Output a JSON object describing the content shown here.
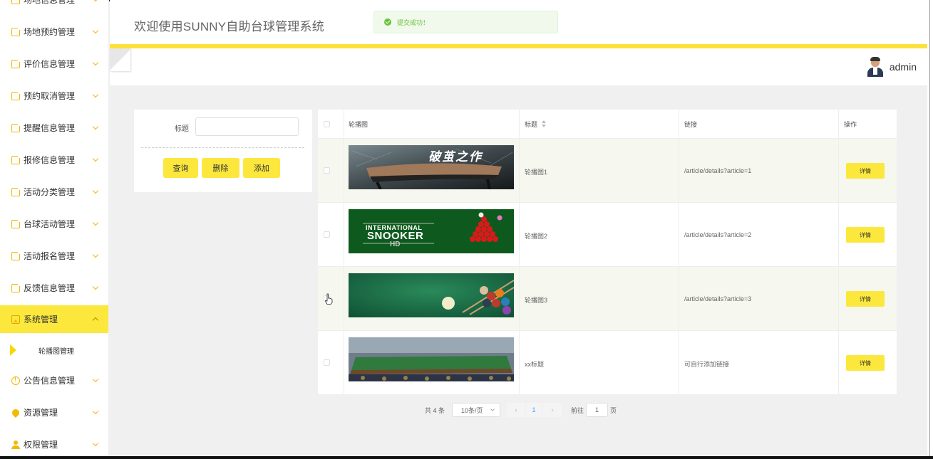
{
  "app": {
    "title": "欢迎使用SUNNY自助台球管理系统",
    "user_name": "admin",
    "toast": "提交成功！"
  },
  "colors": {
    "accent": "#fce83d",
    "accent_bar": "#fde13a",
    "icon": "#f5b800",
    "success": "#67c23a",
    "row_alt": "#f6f7ef"
  },
  "sidebar": {
    "items": [
      {
        "label": "场地信息管理",
        "icon": "square-arrow-icon"
      },
      {
        "label": "场地预约管理",
        "icon": "square-arrow-icon"
      },
      {
        "label": "评价信息管理",
        "icon": "square-arrow-icon"
      },
      {
        "label": "预约取消管理",
        "icon": "square-arrow-icon"
      },
      {
        "label": "提醒信息管理",
        "icon": "square-arrow-icon"
      },
      {
        "label": "报修信息管理",
        "icon": "square-arrow-icon"
      },
      {
        "label": "活动分类管理",
        "icon": "square-arrow-icon"
      },
      {
        "label": "台球活动管理",
        "icon": "square-arrow-icon"
      },
      {
        "label": "活动报名管理",
        "icon": "square-arrow-icon"
      },
      {
        "label": "反馈信息管理",
        "icon": "square-arrow-icon"
      },
      {
        "label": "系统管理",
        "icon": "image-icon",
        "active": true
      },
      {
        "label": "公告信息管理",
        "icon": "info-circle-icon"
      },
      {
        "label": "资源管理",
        "icon": "location-pin-icon"
      },
      {
        "label": "权限管理",
        "icon": "user-icon"
      }
    ],
    "sub_item": "轮播图管理"
  },
  "search": {
    "label": "标题",
    "value": "",
    "query_button": "查询",
    "delete_button": "删除",
    "add_button": "添加"
  },
  "table": {
    "headers": {
      "image": "轮播图",
      "title": "标题",
      "link": "链接",
      "action": "操作"
    },
    "rows": [
      {
        "title": "轮播图1",
        "link": "/article/details?article=1",
        "action": "详情",
        "image_text": "破茧之作"
      },
      {
        "title": "轮播图2",
        "link": "/article/details?article=2",
        "action": "详情",
        "image_text": "INTERNATIONAL",
        "image_text2": "SNOOKER",
        "image_text3": "HD"
      },
      {
        "title": "轮播图3",
        "link": "/article/details?article=3",
        "action": "详情"
      },
      {
        "title": "xx标题",
        "link": "可自行添加链接",
        "action": "详情"
      }
    ]
  },
  "pagination": {
    "total": "共 4 条",
    "page_size": "10条/页",
    "current_page": "1",
    "goto_label": "前往",
    "goto_value": "1",
    "goto_unit": "页"
  }
}
